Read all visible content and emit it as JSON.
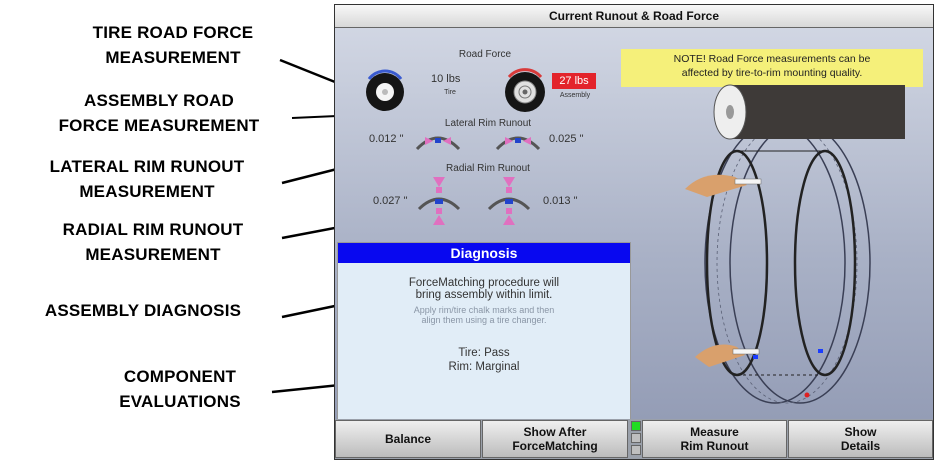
{
  "callouts": {
    "tire_road_force": [
      "TIRE ROAD FORCE",
      "MEASUREMENT"
    ],
    "assembly_road_force": [
      "ASSEMBLY ROAD",
      "FORCE MEASUREMENT"
    ],
    "lateral_rim_runout": [
      "LATERAL RIM RUNOUT",
      "MEASUREMENT"
    ],
    "radial_rim_runout": [
      "RADIAL RIM RUNOUT",
      "MEASUREMENT"
    ],
    "assembly_diagnosis": [
      "ASSEMBLY DIAGNOSIS"
    ],
    "component_evaluations": [
      "COMPONENT",
      "EVALUATIONS"
    ]
  },
  "screen": {
    "title": "Current Runout & Road Force",
    "road_force": {
      "label": "Road Force",
      "tire_value": "10 lbs",
      "tire_label": "Tire",
      "assembly_value": "27 lbs",
      "assembly_label": "Assembly"
    },
    "lateral": {
      "label": "Lateral Rim Runout",
      "left_value": "0.012 \"",
      "right_value": "0.025 \""
    },
    "radial": {
      "label": "Radial Rim Runout",
      "left_value": "0.027 \"",
      "right_value": "0.013 \""
    },
    "note": [
      "NOTE!  Road Force measurements can be",
      "affected by tire-to-rim mounting quality."
    ],
    "diagnosis": {
      "header": "Diagnosis",
      "line1": "ForceMatching procedure will",
      "line2": "bring assembly within limit.",
      "hint1": "Apply rim/tire chalk marks and then",
      "hint2": "align them using a tire changer.",
      "tire_eval": "Tire:  Pass",
      "rim_eval": "Rim:  Marginal"
    },
    "buttons": {
      "balance": "Balance",
      "show_after_1": "Show After",
      "show_after_2": "ForceMatching",
      "measure_1": "Measure",
      "measure_2": "Rim Runout",
      "details_1": "Show",
      "details_2": "Details"
    },
    "colors": {
      "assembly_badge": "#e3232b",
      "diag_header": "#0808f0",
      "note_bg": "#f5f07a",
      "led_green": "#22dd22"
    }
  }
}
